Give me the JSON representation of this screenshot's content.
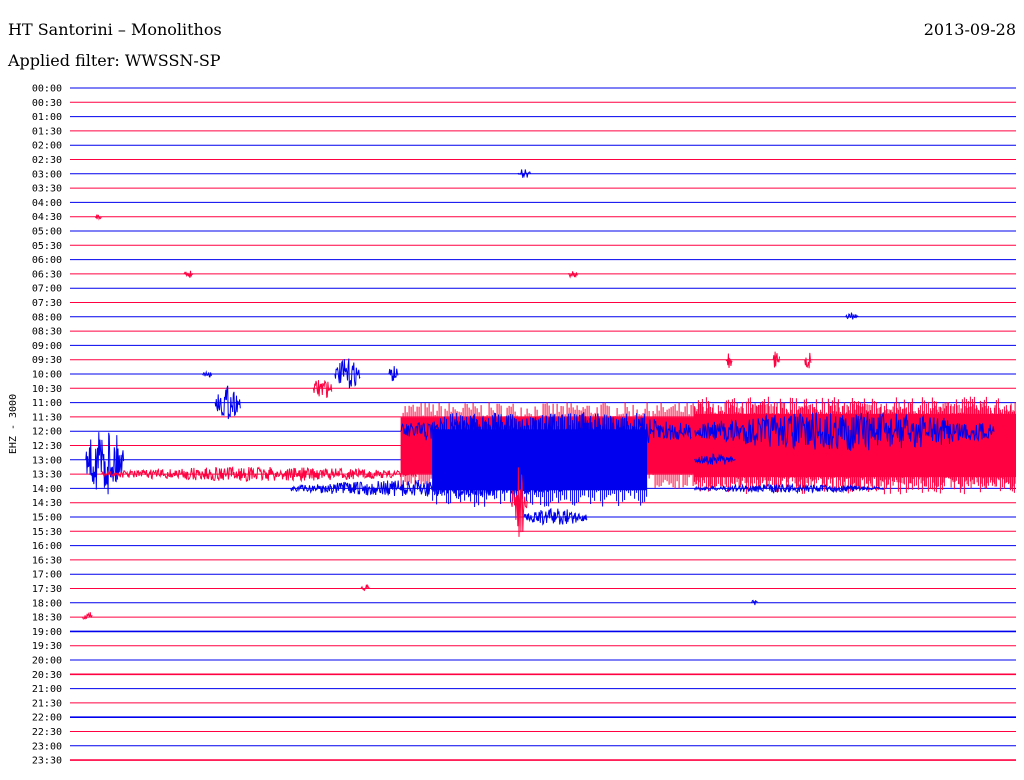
{
  "header": {
    "station": "HT Santorini – Monolithos",
    "filter": "Applied filter: WWSSN-SP",
    "date": "2013-09-28"
  },
  "colors": {
    "a": "#0000ee",
    "b": "#ff0040"
  },
  "chart_data": {
    "type": "line",
    "title": "",
    "ylabel": "EHZ - 3000",
    "row_interval_minutes": 30,
    "row_duration_minutes": 30,
    "tick_labels": [
      "00:00",
      "00:30",
      "01:00",
      "01:30",
      "02:00",
      "02:30",
      "03:00",
      "03:30",
      "04:00",
      "04:30",
      "05:00",
      "05:30",
      "06:00",
      "06:30",
      "07:00",
      "07:30",
      "08:00",
      "08:30",
      "09:00",
      "09:30",
      "10:00",
      "10:30",
      "11:00",
      "11:30",
      "12:00",
      "12:30",
      "13:00",
      "13:30",
      "14:00",
      "14:30",
      "15:00",
      "15:30",
      "16:00",
      "16:30",
      "17:00",
      "17:30",
      "18:00",
      "18:30",
      "19:00",
      "19:30",
      "20:00",
      "20:30",
      "21:00",
      "21:30",
      "22:00",
      "22:30",
      "23:00",
      "23:30"
    ],
    "colors_alternate": [
      "blue",
      "red"
    ],
    "events": [
      {
        "row": 6,
        "minute": 14.2,
        "amp": 0.35,
        "len": 0.4
      },
      {
        "row": 9,
        "minute": 0.8,
        "amp": 0.2,
        "len": 0.2
      },
      {
        "row": 13,
        "minute": 3.6,
        "amp": 0.3,
        "len": 0.3
      },
      {
        "row": 13,
        "minute": 15.8,
        "amp": 0.3,
        "len": 0.3
      },
      {
        "row": 16,
        "minute": 24.6,
        "amp": 0.25,
        "len": 0.4
      },
      {
        "row": 19,
        "minute": 20.8,
        "amp": 0.7,
        "len": 0.2
      },
      {
        "row": 19,
        "minute": 22.3,
        "amp": 0.8,
        "len": 0.2
      },
      {
        "row": 19,
        "minute": 23.3,
        "amp": 0.9,
        "len": 0.2
      },
      {
        "row": 20,
        "minute": 4.2,
        "amp": 0.3,
        "len": 0.3
      },
      {
        "row": 20,
        "minute": 8.4,
        "amp": 1.1,
        "len": 0.8
      },
      {
        "row": 20,
        "minute": 10.1,
        "amp": 0.6,
        "len": 0.3
      },
      {
        "row": 21,
        "minute": 7.7,
        "amp": 0.8,
        "len": 0.6
      },
      {
        "row": 22,
        "minute": 4.6,
        "amp": 1.2,
        "len": 0.8
      },
      {
        "row": 24,
        "minute": 10.5,
        "amp": 1.4,
        "len": 9.2
      },
      {
        "row": 24,
        "minute": 19.8,
        "amp": 1.4,
        "len": 9.5
      },
      {
        "row": 26,
        "minute": 0.5,
        "amp": 2.5,
        "len": 1.2
      },
      {
        "row": 26,
        "minute": 19.8,
        "amp": 0.4,
        "len": 1.3
      },
      {
        "row": 27,
        "minute": 1.0,
        "amp": 0.5,
        "len": 10.0
      },
      {
        "row": 28,
        "minute": 7.0,
        "amp": 0.6,
        "len": 8.6
      },
      {
        "row": 28,
        "minute": 19.8,
        "amp": 0.3,
        "len": 6.0
      },
      {
        "row": 29,
        "minute": 14.0,
        "amp": 2.6,
        "len": 0.5
      },
      {
        "row": 30,
        "minute": 14.4,
        "amp": 0.6,
        "len": 2.0
      },
      {
        "row": 35,
        "minute": 9.2,
        "amp": 0.3,
        "len": 0.3
      },
      {
        "row": 36,
        "minute": 21.6,
        "amp": 0.2,
        "len": 0.2
      },
      {
        "row": 37,
        "minute": 0.4,
        "amp": 0.6,
        "len": 0.3
      }
    ],
    "bursts": [
      {
        "row": 25,
        "start_minute": 10.5,
        "end_minute": 30,
        "amp": 2.4
      },
      {
        "row": 26,
        "start_minute": 11.5,
        "end_minute": 18.3,
        "amp": 2.6
      },
      {
        "row": 25,
        "start_minute": 19.8,
        "end_minute": 30,
        "amp": 2.7
      }
    ],
    "noisy_rows": [
      38,
      41,
      44,
      47
    ]
  }
}
